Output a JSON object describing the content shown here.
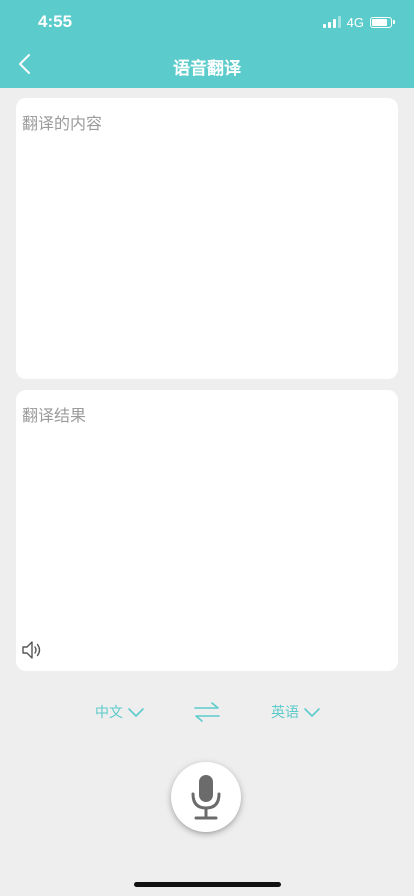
{
  "status_bar": {
    "time": "4:55",
    "network": "4G"
  },
  "nav": {
    "title": "语音翻译"
  },
  "source": {
    "placeholder": "翻译的内容"
  },
  "result": {
    "placeholder": "翻译结果"
  },
  "languages": {
    "from": "中文",
    "to": "英语"
  },
  "colors": {
    "accent": "#5ccbcb",
    "background": "#eeeeee",
    "card": "#ffffff",
    "placeholder": "#9b9b9b"
  },
  "icons": {
    "back": "chevron-left-icon",
    "speaker": "speaker-icon",
    "swap": "swap-arrows-icon",
    "dropdown": "chevron-down-icon",
    "mic": "microphone-icon"
  }
}
